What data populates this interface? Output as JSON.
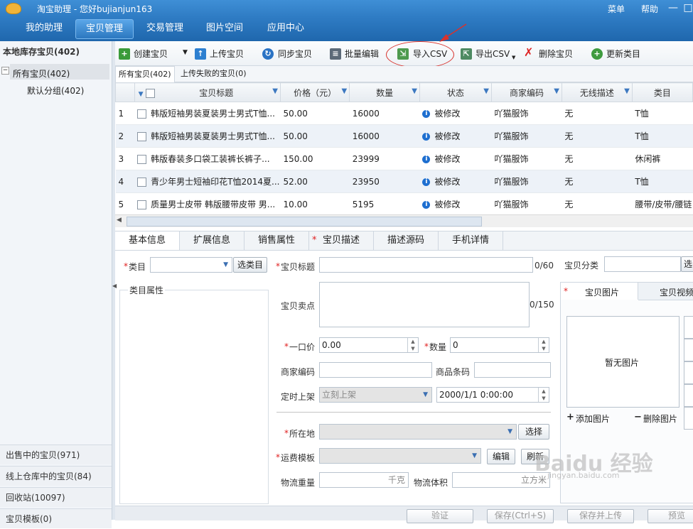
{
  "titlebar": {
    "title": "淘宝助理 - 您好bujianjun163",
    "menu": "菜单",
    "help": "帮助",
    "minimize": "—",
    "close": "□"
  },
  "nav": {
    "tabs": [
      "我的助理",
      "宝贝管理",
      "交易管理",
      "图片空间",
      "应用中心"
    ],
    "active": 1
  },
  "sidebar": {
    "header": "本地库存宝贝(402)",
    "tree_toggle": "−",
    "all_items": "所有宝贝(402)",
    "default_group": "默认分组(402)",
    "bottom_items": [
      "出售中的宝贝(971)",
      "线上仓库中的宝贝(84)",
      "回收站(10097)",
      "宝贝模板(0)"
    ]
  },
  "toolbar": {
    "create": "创建宝贝",
    "upload": "上传宝贝",
    "sync": "同步宝贝",
    "batch_edit": "批量编辑",
    "import_csv": "导入CSV",
    "export_csv": "导出CSV",
    "delete": "删除宝贝",
    "update_category": "更新类目"
  },
  "subtabs": {
    "all": "所有宝贝(402)",
    "failed": "上传失败的宝贝(0)"
  },
  "grid": {
    "columns": [
      "宝贝标题",
      "价格（元）",
      "数量",
      "状态",
      "商家编码",
      "无线描述",
      "类目"
    ],
    "rows": [
      {
        "num": "1",
        "title": "韩版短袖男装夏装男士男式T恤...",
        "price": "50.00",
        "qty": "16000",
        "status": "被修改",
        "code": "吖猫服饰",
        "wireless": "无",
        "category": "T恤"
      },
      {
        "num": "2",
        "title": "韩版短袖男装夏装男士男式T恤...",
        "price": "50.00",
        "qty": "16000",
        "status": "被修改",
        "code": "吖猫服饰",
        "wireless": "无",
        "category": "T恤"
      },
      {
        "num": "3",
        "title": "韩版春装多口袋工装裤长裤子...",
        "price": "150.00",
        "qty": "23999",
        "status": "被修改",
        "code": "吖猫服饰",
        "wireless": "无",
        "category": "休闲裤"
      },
      {
        "num": "4",
        "title": "青少年男士短袖印花T恤2014夏...",
        "price": "52.00",
        "qty": "23950",
        "status": "被修改",
        "code": "吖猫服饰",
        "wireless": "无",
        "category": "T恤"
      },
      {
        "num": "5",
        "title": "质量男士皮带 韩版腰带皮带 男...",
        "price": "10.00",
        "qty": "5195",
        "status": "被修改",
        "code": "吖猫服饰",
        "wireless": "无",
        "category": "腰带/皮带/腰链"
      }
    ]
  },
  "detail_tabs": {
    "items": [
      "基本信息",
      "扩展信息",
      "销售属性",
      "宝贝描述",
      "描述源码",
      "手机详情"
    ],
    "required_marker": "*"
  },
  "form": {
    "required_marker": "*",
    "category_label": "类目",
    "select_category": "选类目",
    "category_attrs": "类目属性",
    "title_label": "宝贝标题",
    "title_count": "0/60",
    "item_group_label": "宝贝分类",
    "item_group_btn": "选",
    "selling_label": "宝贝卖点",
    "selling_count": "0/150",
    "price_label": "一口价",
    "price_value": "0.00",
    "qty_label": "数量",
    "qty_value": "0",
    "merchant_code": "商家编码",
    "barcode": "商品条码",
    "schedule_label": "定时上架",
    "schedule_value": "立刻上架",
    "datetime_value": "2000/1/1 0:00:00",
    "location_label": "所在地",
    "location_btn": "选择",
    "shipping_label": "运费模板",
    "edit_btn": "编辑",
    "refresh_btn": "刷新",
    "weight_label": "物流重量",
    "weight_unit": "千克",
    "volume_label": "物流体积",
    "volume_unit": "立方米"
  },
  "media": {
    "pic_tab": "宝贝图片",
    "video_tab": "宝贝视频",
    "no_pic": "暂无图片",
    "add_pic": "添加图片",
    "del_pic": "删除图片"
  },
  "bottom": {
    "buttons": [
      "验证",
      "保存(Ctrl+S)",
      "保存并上传",
      "预览"
    ]
  },
  "watermark": {
    "main": "Baidu 经验",
    "sub": "jingyan.baidu.com"
  },
  "colors": {
    "nav_blue": "#2f7cc4",
    "annotation_red": "#d8322c"
  }
}
